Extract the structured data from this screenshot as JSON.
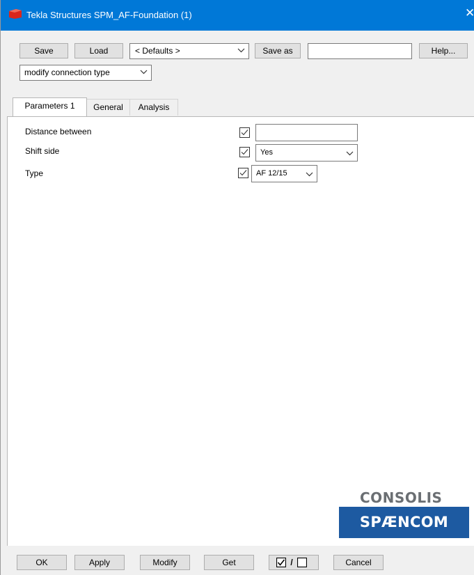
{
  "window": {
    "title": "Tekla Structures  SPM_AF-Foundation (1)",
    "close_glyph": "✕"
  },
  "toolbar": {
    "save_label": "Save",
    "load_label": "Load",
    "attribute_set_value": "< Defaults >",
    "save_as_label": "Save as",
    "save_as_name_value": "",
    "help_label": "Help...",
    "mode_value": "modify connection type"
  },
  "tabs": [
    {
      "label": "Parameters 1",
      "active": true
    },
    {
      "label": "General",
      "active": false
    },
    {
      "label": "Analysis",
      "active": false
    }
  ],
  "parameters": [
    {
      "label": "Distance between",
      "checked": true,
      "control": "text",
      "value": ""
    },
    {
      "label": "Shift side",
      "checked": true,
      "control": "select",
      "value": "Yes"
    },
    {
      "label": "Type",
      "checked": true,
      "control": "select",
      "value": "AF 12/15"
    }
  ],
  "logo": {
    "company": "CONSOLIS",
    "brand": "SPÆNCOM",
    "brand_color": "#1d5aa1",
    "company_color": "#6b6f73"
  },
  "footer": {
    "ok_label": "OK",
    "apply_label": "Apply",
    "modify_label": "Modify",
    "get_label": "Get",
    "toggle_separator": "/",
    "cancel_label": "Cancel"
  },
  "colors": {
    "titlebar": "#0078d7",
    "window_bg": "#f0f0f0"
  }
}
